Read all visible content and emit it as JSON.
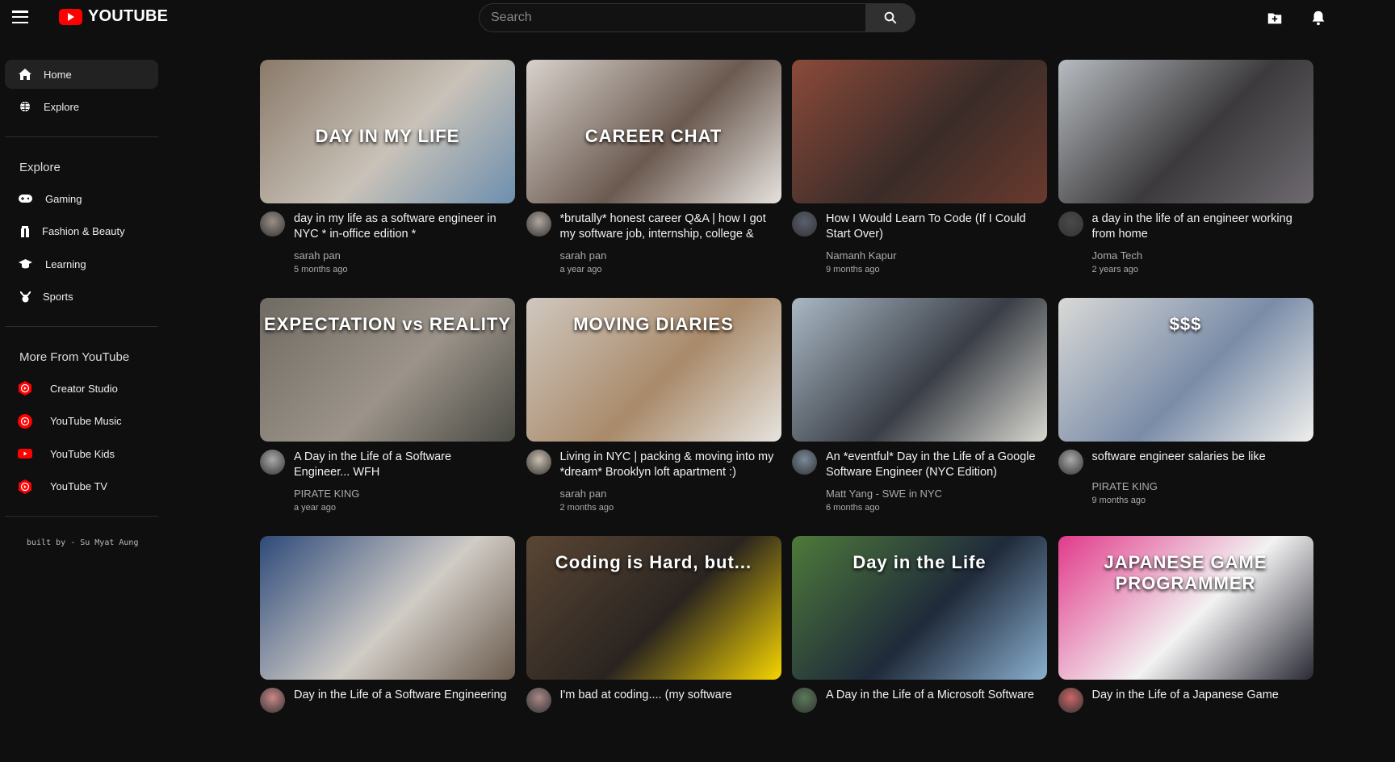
{
  "header": {
    "logo": "YOUTUBE",
    "search_placeholder": "Search",
    "icons": [
      "menu-icon",
      "search-icon",
      "video-add-icon",
      "bell-icon"
    ]
  },
  "sidebar": {
    "main": [
      {
        "label": "Home",
        "icon": "home-icon",
        "active": true
      },
      {
        "label": "Explore",
        "icon": "globe-icon"
      }
    ],
    "explore_title": "Explore",
    "explore": [
      {
        "label": "Gaming",
        "icon": "gamepad-icon"
      },
      {
        "label": "Fashion & Beauty",
        "icon": "fashion-icon"
      },
      {
        "label": "Learning",
        "icon": "graduation-cap-icon"
      },
      {
        "label": "Sports",
        "icon": "medal-icon"
      }
    ],
    "more_title": "More From YouTube",
    "more": [
      {
        "label": "Creator Studio",
        "icon": "creator-studio-icon"
      },
      {
        "label": "YouTube Music",
        "icon": "youtube-music-icon"
      },
      {
        "label": "YouTube Kids",
        "icon": "youtube-kids-icon"
      },
      {
        "label": "YouTube TV",
        "icon": "youtube-tv-icon"
      }
    ],
    "credit": "built by - Su Myat Aung"
  },
  "colors": {
    "accent": "#ff0000",
    "background": "#0f0f0f"
  },
  "videos": [
    {
      "title": "day in my life as a software engineer in NYC * in-office edition *",
      "channel": "sarah pan",
      "time": "5 months ago",
      "overlay": "DAY IN MY LIFE",
      "thumb": [
        "#8a7a6a",
        "#c9c2b8",
        "#6d8fae"
      ],
      "avatar": "#9a8f86"
    },
    {
      "title": "*brutally* honest career Q&A | how I got my software job, internship, college &",
      "channel": "sarah pan",
      "time": "a year ago",
      "overlay": "CAREER CHAT",
      "thumb": [
        "#d8d2cc",
        "#6b5a50",
        "#e6e2de"
      ],
      "avatar": "#b0a69e"
    },
    {
      "title": "How I Would Learn To Code (If I Could Start Over)",
      "channel": "Namanh Kapur",
      "time": "9 months ago",
      "overlay": "",
      "thumb": [
        "#8b4a3a",
        "#3a2c28",
        "#6a3a2e"
      ],
      "avatar": "#5a6070"
    },
    {
      "title": "a day in the life of an engineer working from home",
      "channel": "Joma Tech",
      "time": "2 years ago",
      "overlay": "",
      "thumb": [
        "#b7bcc0",
        "#3c3a3c",
        "#6e6a70"
      ],
      "avatar": "#4a4a4a"
    },
    {
      "title": "A Day in the Life of a Software Engineer... WFH",
      "channel": "PIRATE KING",
      "time": "a year ago",
      "overlay": "EXPECTATION vs REALITY",
      "thumb": [
        "#6f6a62",
        "#9c948a",
        "#4a4a44"
      ],
      "avatar": "#aaa"
    },
    {
      "title": "Living in NYC | packing & moving into my *dream* Brooklyn loft apartment :)",
      "channel": "sarah pan",
      "time": "2 months ago",
      "overlay": "MOVING DIARIES",
      "thumb": [
        "#cfc8bf",
        "#a98a6a",
        "#e6e3de"
      ],
      "avatar": "#cbbfb0"
    },
    {
      "title": "An *eventful* Day in the Life of a Google Software Engineer (NYC Edition)",
      "channel": "Matt Yang - SWE in NYC",
      "time": "6 months ago",
      "overlay": "",
      "thumb": [
        "#a9b8c4",
        "#3a3e46",
        "#d8d8d0"
      ],
      "avatar": "#7a8a9a"
    },
    {
      "title": "software engineer salaries be like",
      "channel": "PIRATE KING",
      "time": "9 months ago",
      "overlay": "$$$",
      "thumb": [
        "#d9d9d6",
        "#7a8ca8",
        "#efefec"
      ],
      "avatar": "#aaa"
    },
    {
      "title": "Day in the Life of a Software Engineering",
      "channel": "",
      "time": "",
      "overlay": "",
      "thumb": [
        "#2e4a7a",
        "#d0ccc6",
        "#6a5a4c"
      ],
      "avatar": "#c88"
    },
    {
      "title": "I'm bad at coding.... (my software",
      "channel": "",
      "time": "",
      "overlay": "Coding is Hard, but...",
      "thumb": [
        "#5a4634",
        "#2a2420",
        "#f5d400"
      ],
      "avatar": "#a88"
    },
    {
      "title": "A Day in the Life of a Microsoft Software",
      "channel": "",
      "time": "",
      "overlay": "Day in the Life",
      "thumb": [
        "#4e7a3a",
        "#1f2a3a",
        "#8ab0d0"
      ],
      "avatar": "#5a7a5a"
    },
    {
      "title": "Day in the Life of a Japanese Game",
      "channel": "",
      "time": "",
      "overlay": "JAPANESE GAME PROGRAMMER",
      "thumb": [
        "#e23a8a",
        "#f2f2f2",
        "#2a2a36"
      ],
      "avatar": "#c66"
    }
  ]
}
